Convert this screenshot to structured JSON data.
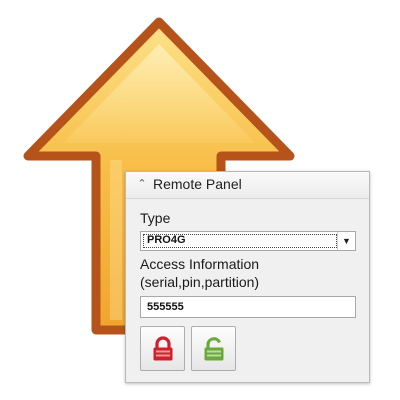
{
  "panel": {
    "title": "Remote Panel",
    "collapse_icon": "chevron-up-icon",
    "type_label": "Type",
    "type_select": {
      "value": "PRO4G",
      "icon": "dropdown-arrow-icon"
    },
    "access_label_line1": "Access Information",
    "access_label_line2": "(serial,pin,partition)",
    "access_input": {
      "value": "555555"
    },
    "buttons": [
      {
        "icon": "lock-icon",
        "color": "#d0202a"
      },
      {
        "icon": "unlock-icon",
        "color": "#6aaa3a"
      }
    ]
  },
  "background": {
    "icon": "up-arrow-icon",
    "colors": {
      "fill": "#f6b73c",
      "outline": "#b5531a"
    }
  }
}
